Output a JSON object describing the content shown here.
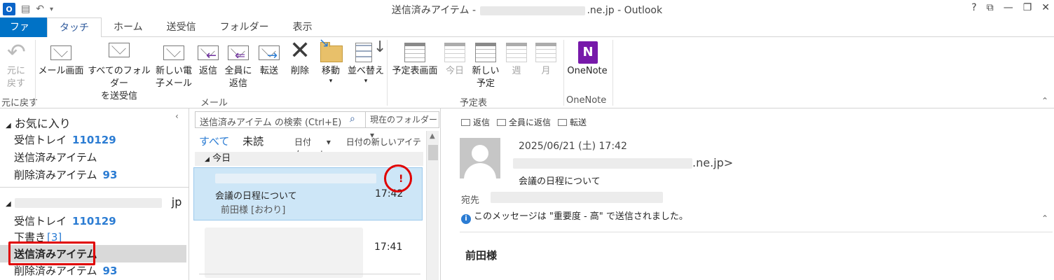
{
  "window": {
    "title_prefix": "送信済みアイテム - ",
    "title_suffix": ".ne.jp - Outlook",
    "help": "?",
    "controls": [
      "⧉",
      "—",
      "❐",
      "✕"
    ]
  },
  "quick_access": {
    "logo_letter": "O",
    "icons": [
      "save-icon",
      "undo-icon",
      "customize-icon"
    ]
  },
  "tabs": [
    "ファイル",
    "タッチ",
    "ホーム",
    "送受信",
    "フォルダー",
    "表示"
  ],
  "ribbon": {
    "undo": {
      "label1": "元に",
      "label2": "戻す",
      "group": "元に戻す"
    },
    "mail_group": {
      "label": "メール",
      "buttons": {
        "mail_view": "メール画面",
        "send_receive_all1": "すべてのフォルダー",
        "send_receive_all2": "を送受信",
        "new_email1": "新しい電",
        "new_email2": "子メール",
        "reply": "返信",
        "reply_all1": "全員に",
        "reply_all2": "返信",
        "forward": "転送",
        "delete": "削除",
        "move": "移動",
        "sort": "並べ替え"
      }
    },
    "calendar_group": {
      "label": "予定表",
      "buttons": {
        "calendar_view": "予定表画面",
        "today": "今日",
        "new_appointment1": "新しい",
        "new_appointment2": "予定",
        "week": "週",
        "month": "月"
      }
    },
    "onenote_group": {
      "label": "OneNote",
      "button": "OneNote"
    }
  },
  "folder_pane": {
    "favorites_header": "お気に入り",
    "favorites": [
      {
        "label": "受信トレイ",
        "count": "110129"
      },
      {
        "label": "送信済みアイテム",
        "count": ""
      },
      {
        "label": "削除済みアイテム",
        "count": "93"
      }
    ],
    "account_suffix": "jp",
    "account_items": {
      "inbox": {
        "label": "受信トレイ",
        "count": "110129"
      },
      "drafts": {
        "label": "下書き",
        "count": "[3]"
      },
      "sent": {
        "label": "送信済みアイテム"
      },
      "deleted": {
        "label": "削除済みアイテム",
        "count": "93"
      }
    }
  },
  "message_list": {
    "search_placeholder": "送信済みアイテム の検索 (Ctrl+E)",
    "search_scope": "現在のフォルダー",
    "filter_all": "すべて",
    "filter_unread": "未読",
    "sort_by": "日付",
    "sort_order": "日付の新しいアイテム",
    "group_today": "今日",
    "messages": [
      {
        "subject": "会議の日程について",
        "preview": "前田様 [おわり]",
        "time": "17:42",
        "importance": "!"
      },
      {
        "time": "17:41"
      }
    ]
  },
  "reading_pane": {
    "actions": [
      "返信",
      "全員に返信",
      "転送"
    ],
    "date": "2025/06/21 (土) 17:42",
    "sender_suffix": ".ne.jp>",
    "subject": "会議の日程について",
    "to_label": "宛先",
    "info": "このメッセージは \"重要度 - 高\" で送信されました。",
    "body_greeting": "前田様"
  }
}
